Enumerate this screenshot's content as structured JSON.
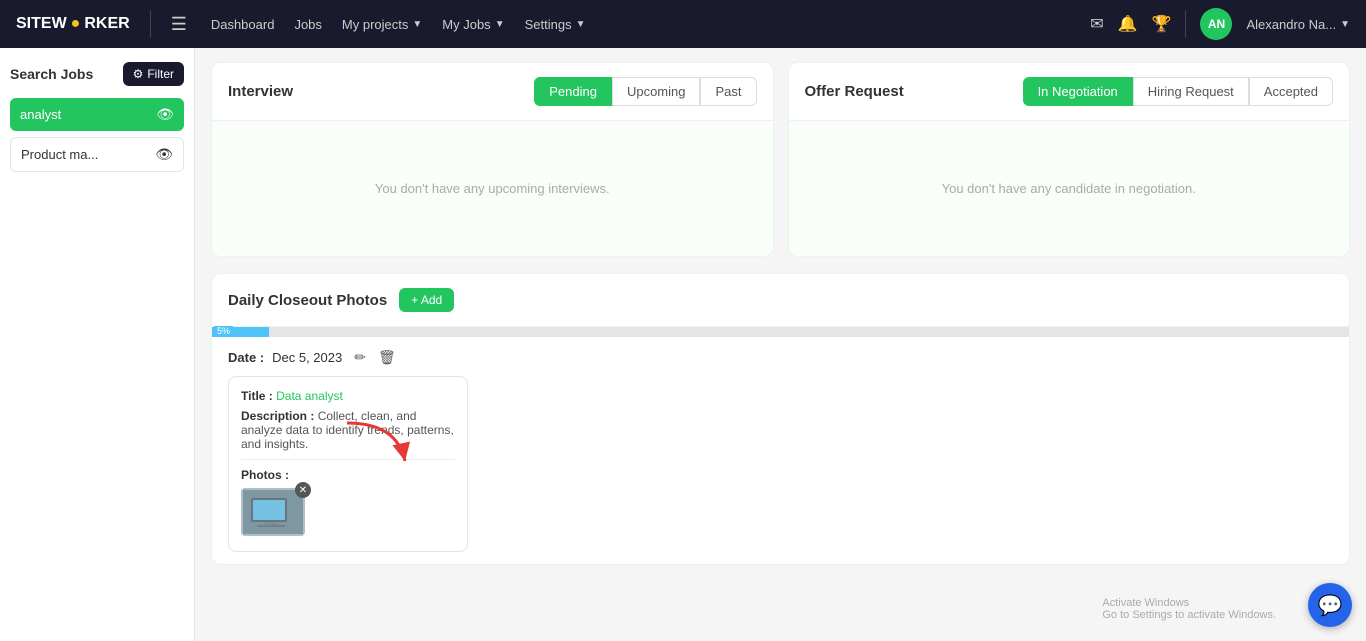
{
  "topnav": {
    "logo": "SITEW",
    "logo_dot": "●",
    "logo_rest": "RKER",
    "hamburger": "☰",
    "links": [
      {
        "label": "Dashboard",
        "has_chevron": false
      },
      {
        "label": "Jobs",
        "has_chevron": false
      },
      {
        "label": "My projects",
        "has_chevron": true
      },
      {
        "label": "My Jobs",
        "has_chevron": true
      },
      {
        "label": "Settings",
        "has_chevron": true
      }
    ],
    "icons": [
      "✉",
      "🔔",
      "🏆"
    ],
    "avatar_initials": "AN",
    "avatar_name": "Alexandro Na..."
  },
  "sidebar": {
    "title": "Search Jobs",
    "filter_label": "Filter",
    "items": [
      {
        "label": "analyst",
        "active": true
      },
      {
        "label": "Product ma...",
        "active": false
      }
    ]
  },
  "interview": {
    "title": "Interview",
    "tabs": [
      {
        "label": "Pending",
        "active": true
      },
      {
        "label": "Upcoming",
        "active": false
      },
      {
        "label": "Past",
        "active": false
      }
    ],
    "empty_message": "You don't have any upcoming interviews."
  },
  "offer_request": {
    "title": "Offer Request",
    "tabs": [
      {
        "label": "In Negotiation",
        "active": true
      },
      {
        "label": "Hiring Request",
        "active": false
      },
      {
        "label": "Accepted",
        "active": false
      }
    ],
    "empty_message": "You don't have any candidate in negotiation."
  },
  "daily_closeout": {
    "title": "Daily Closeout Photos",
    "add_label": "+ Add",
    "progress_percent": "5%",
    "date_label": "Date :",
    "date_value": "Dec 5, 2023",
    "entry": {
      "title_label": "Title :",
      "title_value": "Data analyst",
      "description_label": "Description :",
      "description_value": "Collect, clean, and analyze data to identify trends, patterns, and insights.",
      "photos_label": "Photos :"
    }
  },
  "windows": {
    "line1": "Activate Windows",
    "line2": "Go to Settings to activate Windows."
  },
  "chat_icon": "💬"
}
